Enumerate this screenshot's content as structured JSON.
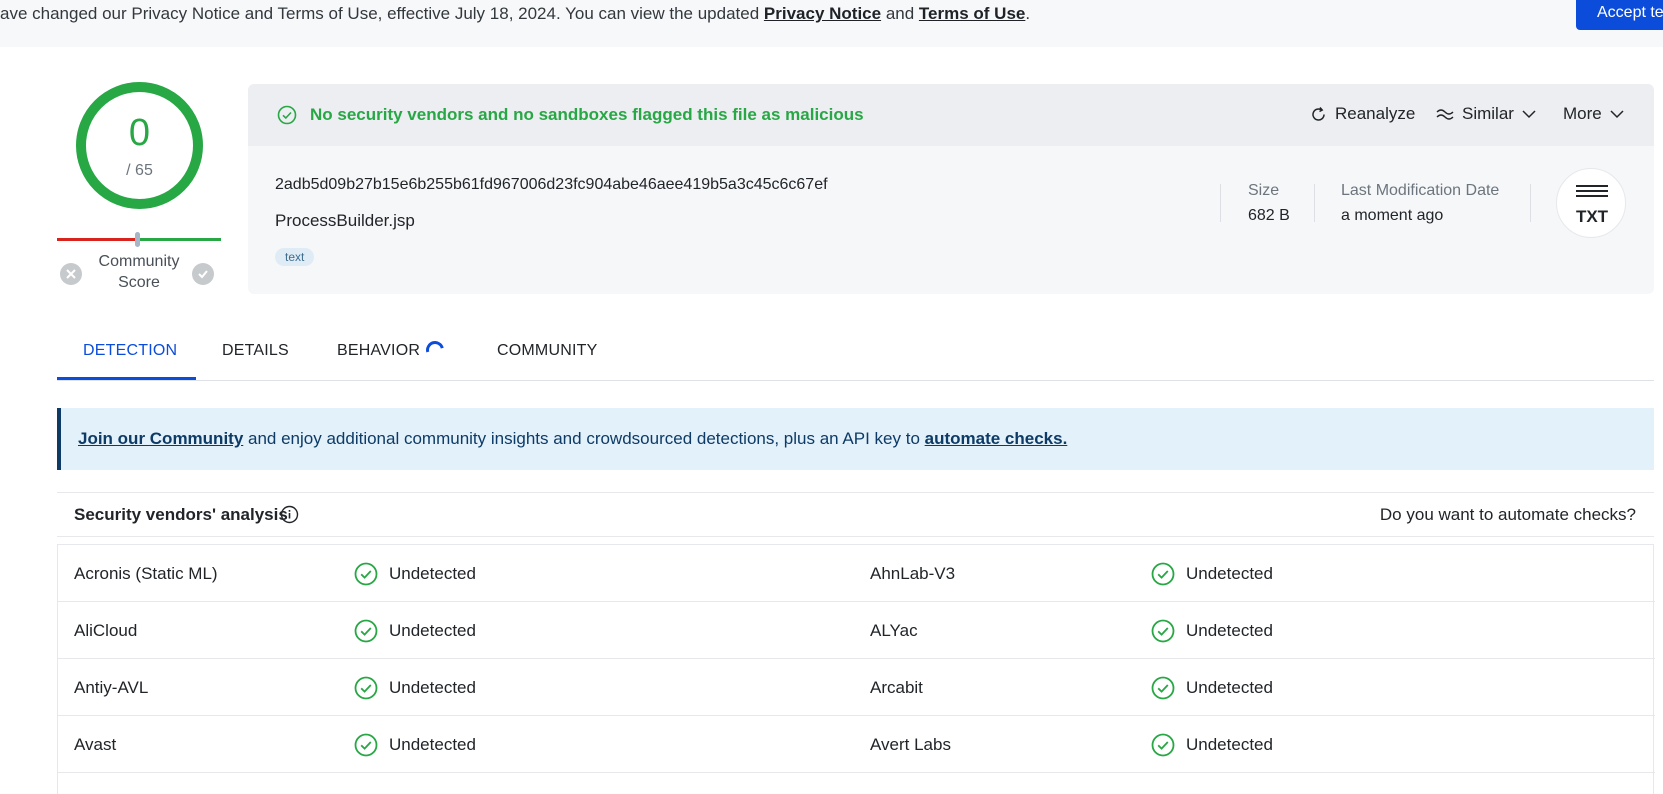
{
  "banner": {
    "text_prefix": "ave changed our Privacy Notice and Terms of Use, effective July 18, 2024. You can view the updated ",
    "privacy_link": "Privacy Notice",
    "and": " and ",
    "terms_link": "Terms of Use",
    "suffix": ".",
    "accept_button": "Accept ter"
  },
  "score": {
    "detections": "0",
    "total": "/ 65",
    "community_label_1": "Community",
    "community_label_2": "Score"
  },
  "summary": {
    "status": "No security vendors and no sandboxes flagged this file as malicious",
    "actions": {
      "reanalyze": "Reanalyze",
      "similar": "Similar",
      "more": "More"
    },
    "hash": "2adb5d09b27b15e6b255b61fd967006d23fc904abe46aee419b5a3c45c6c67ef",
    "filename": "ProcessBuilder.jsp",
    "tag": "text",
    "size_label": "Size",
    "size_value": "682 B",
    "last_mod_label": "Last Modification Date",
    "last_mod_value": "a moment ago",
    "file_type": "TXT"
  },
  "tabs": {
    "detection": "DETECTION",
    "details": "DETAILS",
    "behavior": "BEHAVIOR",
    "community": "COMMUNITY"
  },
  "alert": {
    "join_link": "Join our Community",
    "middle": " and enjoy additional community insights and crowdsourced detections, plus an API key to ",
    "automate_link": "automate checks."
  },
  "vendors": {
    "title": "Security vendors' analysis",
    "automate_question": "Do you want to automate checks?",
    "rows": [
      {
        "left_name": "Acronis (Static ML)",
        "left_result": "Undetected",
        "right_name": "AhnLab-V3",
        "right_result": "Undetected"
      },
      {
        "left_name": "AliCloud",
        "left_result": "Undetected",
        "right_name": "ALYac",
        "right_result": "Undetected"
      },
      {
        "left_name": "Antiy-AVL",
        "left_result": "Undetected",
        "right_name": "Arcabit",
        "right_result": "Undetected"
      },
      {
        "left_name": "Avast",
        "left_result": "Undetected",
        "right_name": "Avert Labs",
        "right_result": "Undetected"
      },
      {
        "left_name": "",
        "left_result": "",
        "right_name": "",
        "right_result": ""
      }
    ]
  },
  "colors": {
    "clean": "#28a745",
    "accent": "#0b4dda",
    "malicious": "#d9231d"
  }
}
